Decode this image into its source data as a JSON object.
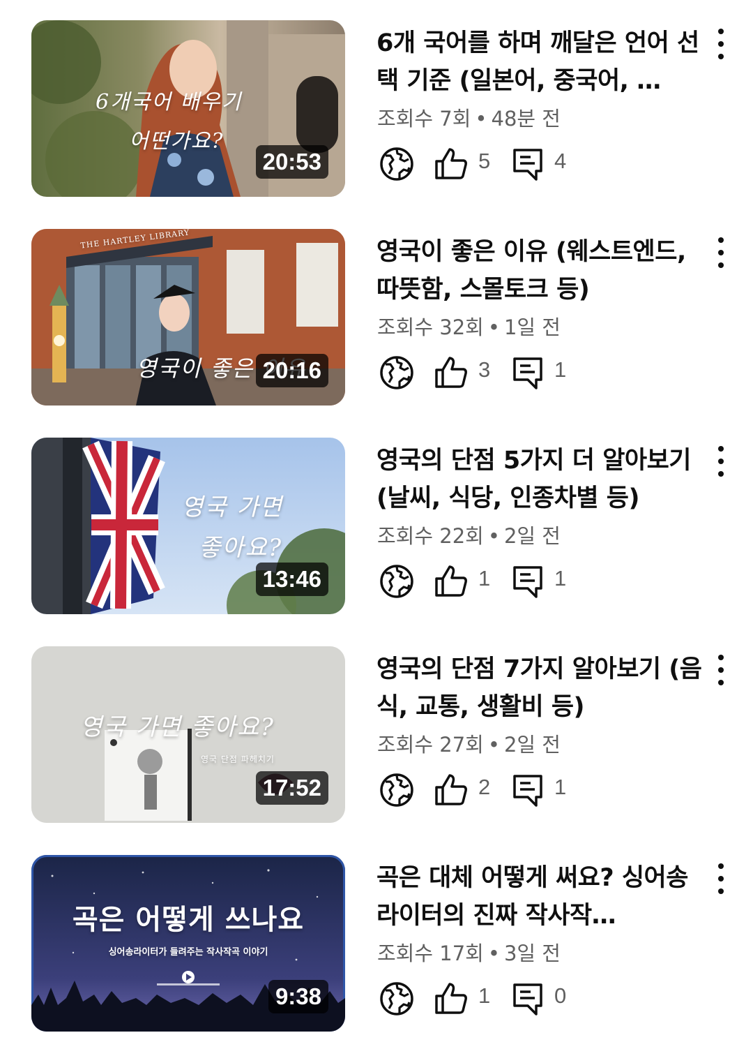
{
  "videos": [
    {
      "title": "6개 국어를 하며 깨달은 언어 선택 기준 (일본어, 중국어, …",
      "views": "조회수 7회",
      "age": "48분 전",
      "likes": "5",
      "comments": "4",
      "duration": "20:53",
      "thumb_text": [
        "6개국어 배우기",
        "어떤가요?"
      ]
    },
    {
      "title": "영국이 좋은 이유 (웨스트엔드, 따뜻함, 스몰토크 등)",
      "views": "조회수 32회",
      "age": "1일 전",
      "likes": "3",
      "comments": "1",
      "duration": "20:16",
      "thumb_text": [
        "THE HARTLEY LIBRARY",
        "영국이 좋은 이유"
      ]
    },
    {
      "title": "영국의 단점 5가지 더 알아보기 (날씨, 식당, 인종차별 등)",
      "views": "조회수 22회",
      "age": "2일 전",
      "likes": "1",
      "comments": "1",
      "duration": "13:46",
      "thumb_text": [
        "영국 가면",
        "좋아요?"
      ]
    },
    {
      "title": "영국의 단점 7가지 알아보기 (음식, 교통, 생활비 등)",
      "views": "조회수 27회",
      "age": "2일 전",
      "likes": "2",
      "comments": "1",
      "duration": "17:52",
      "thumb_text": [
        "영국 가면 좋아요?",
        "영국 단점 파헤치기"
      ]
    },
    {
      "title": "곡은 대체 어떻게 써요? 싱어송라이터의 진짜 작사작…",
      "views": "조회수 17회",
      "age": "3일 전",
      "likes": "1",
      "comments": "0",
      "duration": "9:38",
      "thumb_text": [
        "곡은 어떻게 쓰나요",
        "싱어송라이터가 들려주는 작사작곡 이야기"
      ]
    }
  ],
  "separator": "•",
  "icons": {
    "visibility": "globe-icon",
    "likes": "thumbs-up-icon",
    "comments": "comment-icon",
    "more": "more-vert-icon"
  }
}
